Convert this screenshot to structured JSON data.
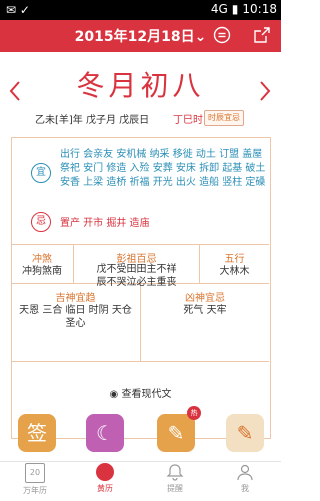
{
  "status_bar": {
    "time": "10:18",
    "signal": "4G"
  },
  "header": {
    "date_title": "2015年12月18日",
    "date_chevron": "⌄"
  },
  "day": {
    "lunar_title": "冬月初八",
    "ganzhi": "乙未[羊]年 戊子月 戊辰日",
    "shichen": "丁巳时",
    "shichen_button": "时辰宜忌"
  },
  "yi": {
    "badge": "宜",
    "text": "出行 会亲友 安机械 纳采 移徙 动土 订盟 盖屋 祭祀 安门 修造 入殓 安葬 安床 拆卸 起基 破土 安香 上梁 造桥 祈福 开光 出火 造船 竖柱 定磉"
  },
  "ji": {
    "badge": "忌",
    "text": "置产 开市 掘井 造庙"
  },
  "grid": {
    "chongsha": {
      "title": "冲煞",
      "value": "冲狗煞南"
    },
    "pengzu": {
      "title": "彭祖百忌",
      "line1": "戊不受田田主不祥",
      "line2": "辰不哭泣必主重丧"
    },
    "wuxing": {
      "title": "五行",
      "value": "大林木"
    },
    "jishen": {
      "title": "吉神宜趋",
      "line1": "天恩 三合 临日 时阴 天仓",
      "line2": "圣心"
    },
    "xiongshen": {
      "title": "凶神宜忌",
      "value": "死气 天牢"
    }
  },
  "view_modern": "查看现代文",
  "features": [
    {
      "icon": "签"
    },
    {
      "icon": "☾"
    },
    {
      "icon": "✎",
      "badge": "热"
    },
    {
      "icon": "✎"
    }
  ],
  "tabs": [
    {
      "label": "万年历",
      "icon": "20"
    },
    {
      "label": "黄历"
    },
    {
      "label": "提醒"
    },
    {
      "label": "我"
    }
  ],
  "colors": {
    "accent": "#d9333f",
    "yi": "#2b8fb7",
    "gold": "#d9742e"
  }
}
